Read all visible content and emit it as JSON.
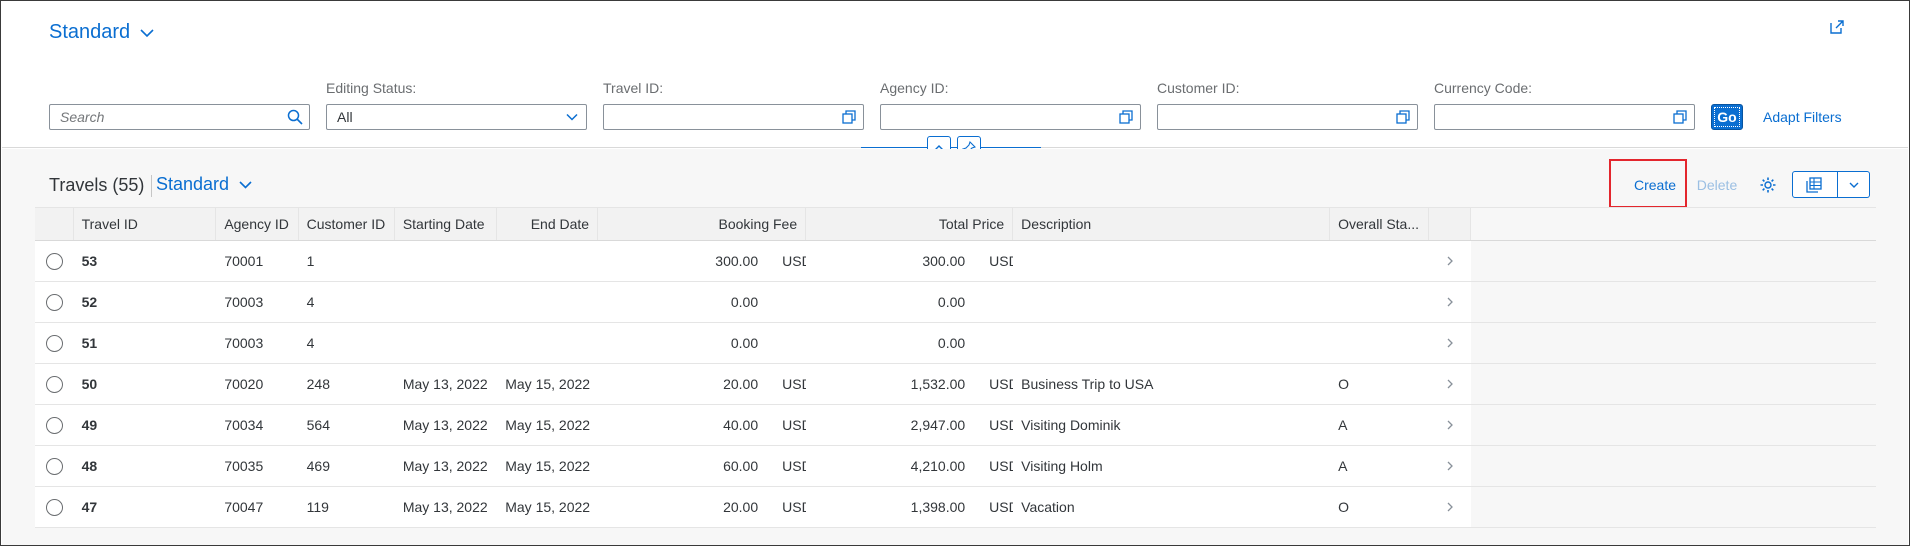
{
  "header": {
    "variant_label": "Standard"
  },
  "filters": {
    "search_placeholder": "Search",
    "editing_status": {
      "label": "Editing Status:",
      "value": "All"
    },
    "travel_id": {
      "label": "Travel ID:"
    },
    "agency_id": {
      "label": "Agency ID:"
    },
    "customer_id": {
      "label": "Customer ID:"
    },
    "currency_code": {
      "label": "Currency Code:"
    },
    "go_label": "Go",
    "adapt_label": "Adapt Filters"
  },
  "table_toolbar": {
    "title": "Travels (55)",
    "variant_label": "Standard",
    "create_label": "Create",
    "delete_label": "Delete"
  },
  "columns": [
    "Travel ID",
    "Agency ID",
    "Customer ID",
    "Starting Date",
    "End Date",
    "Booking Fee",
    "Total Price",
    "Description",
    "Overall Sta..."
  ],
  "rows": [
    {
      "travel_id": "53",
      "agency_id": "70001",
      "customer_id": "1",
      "start": "",
      "end": "",
      "fee": "300.00",
      "fee_cur": "USD",
      "price": "300.00",
      "price_cur": "USD",
      "desc": "",
      "status": ""
    },
    {
      "travel_id": "52",
      "agency_id": "70003",
      "customer_id": "4",
      "start": "",
      "end": "",
      "fee": "0.00",
      "fee_cur": "",
      "price": "0.00",
      "price_cur": "",
      "desc": "",
      "status": ""
    },
    {
      "travel_id": "51",
      "agency_id": "70003",
      "customer_id": "4",
      "start": "",
      "end": "",
      "fee": "0.00",
      "fee_cur": "",
      "price": "0.00",
      "price_cur": "",
      "desc": "",
      "status": ""
    },
    {
      "travel_id": "50",
      "agency_id": "70020",
      "customer_id": "248",
      "start": "May 13, 2022",
      "end": "May 15, 2022",
      "fee": "20.00",
      "fee_cur": "USD",
      "price": "1,532.00",
      "price_cur": "USD",
      "desc": "Business Trip to USA",
      "status": "O"
    },
    {
      "travel_id": "49",
      "agency_id": "70034",
      "customer_id": "564",
      "start": "May 13, 2022",
      "end": "May 15, 2022",
      "fee": "40.00",
      "fee_cur": "USD",
      "price": "2,947.00",
      "price_cur": "USD",
      "desc": "Visiting Dominik",
      "status": "A"
    },
    {
      "travel_id": "48",
      "agency_id": "70035",
      "customer_id": "469",
      "start": "May 13, 2022",
      "end": "May 15, 2022",
      "fee": "60.00",
      "fee_cur": "USD",
      "price": "4,210.00",
      "price_cur": "USD",
      "desc": "Visiting Holm",
      "status": "A"
    },
    {
      "travel_id": "47",
      "agency_id": "70047",
      "customer_id": "119",
      "start": "May 13, 2022",
      "end": "May 15, 2022",
      "fee": "20.00",
      "fee_cur": "USD",
      "price": "1,398.00",
      "price_cur": "USD",
      "desc": "Vacation",
      "status": "O"
    }
  ],
  "colors": {
    "accent": "#0a6ed1",
    "highlight": "#e3262d"
  }
}
